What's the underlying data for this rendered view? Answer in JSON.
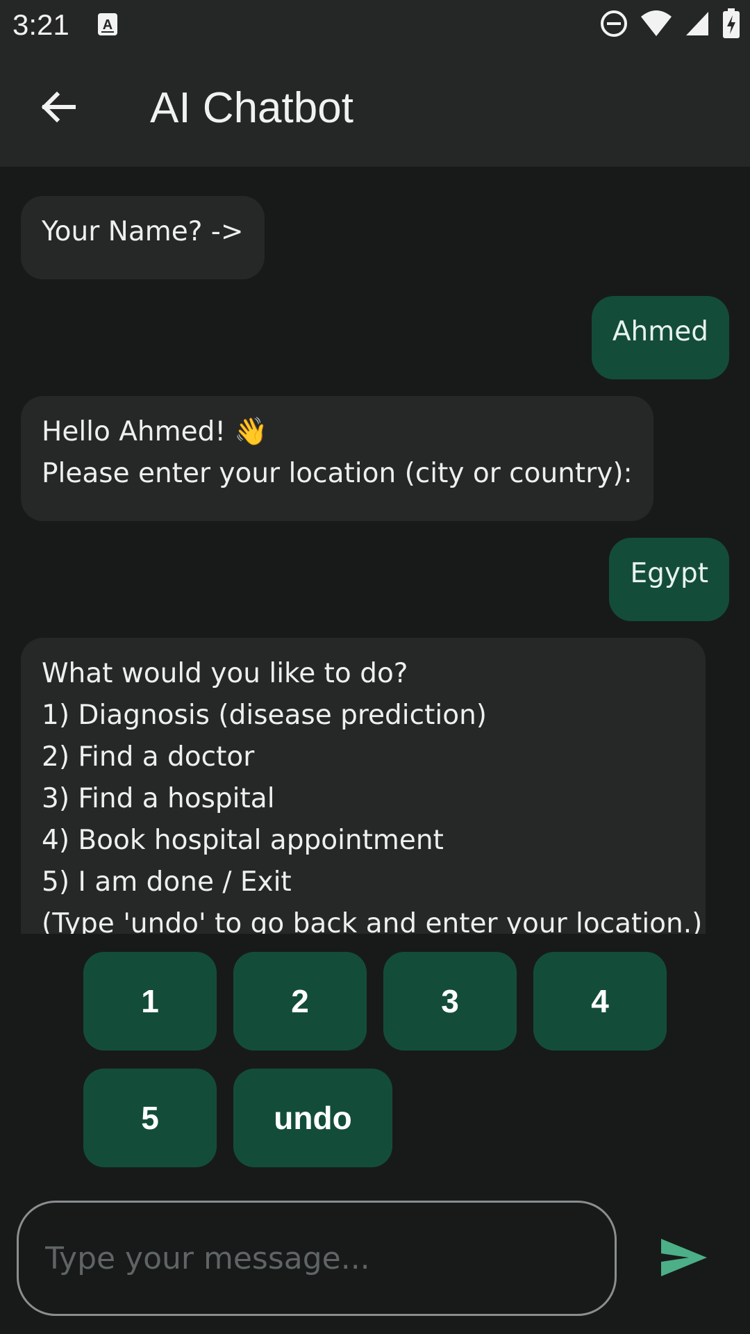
{
  "status_bar": {
    "time": "3:21",
    "icons": [
      "notification-a-icon",
      "do-not-disturb-icon",
      "wifi-icon",
      "cellular-signal-icon",
      "battery-charging-icon"
    ]
  },
  "app_bar": {
    "title": "AI Chatbot",
    "back_icon": "arrow-back-icon"
  },
  "messages": [
    {
      "sender": "bot",
      "text": "Your Name? ->"
    },
    {
      "sender": "user",
      "text": "Ahmed"
    },
    {
      "sender": "bot",
      "text": "Hello Ahmed! 👋\nPlease enter your location (city or country):"
    },
    {
      "sender": "user",
      "text": "Egypt"
    },
    {
      "sender": "bot",
      "text": "What would you like to do?\n1) Diagnosis (disease prediction)\n2) Find a doctor\n3) Find a hospital\n4) Book hospital appointment\n5) I am done / Exit\n(Type 'undo' to go back and enter your location.)"
    }
  ],
  "quick_replies": [
    "1",
    "2",
    "3",
    "4",
    "5",
    "undo"
  ],
  "composer": {
    "placeholder": "Type your message...",
    "value": "",
    "send_icon": "send-icon"
  },
  "colors": {
    "background": "#181a1a",
    "app_bar": "#252727",
    "bot_bubble": "#262828",
    "user_bubble": "#134d3a",
    "accent": "#4caf87"
  }
}
